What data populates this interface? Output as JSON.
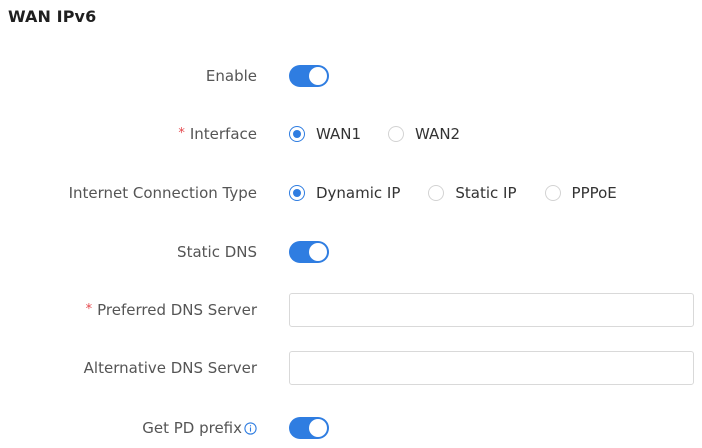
{
  "section": {
    "title": "WAN IPv6"
  },
  "form": {
    "enable": {
      "label": "Enable",
      "on": true
    },
    "interface": {
      "label": "Interface",
      "required_mark": "*",
      "options": [
        "WAN1",
        "WAN2"
      ],
      "selected": "WAN1"
    },
    "connection_type": {
      "label": "Internet Connection Type",
      "options": [
        "Dynamic IP",
        "Static IP",
        "PPPoE"
      ],
      "selected": "Dynamic IP"
    },
    "static_dns": {
      "label": "Static DNS",
      "on": true
    },
    "preferred_dns": {
      "label": "Preferred DNS Server",
      "required_mark": "*",
      "value": ""
    },
    "alternative_dns": {
      "label": "Alternative DNS Server",
      "value": ""
    },
    "pd_prefix": {
      "label": "Get PD prefix",
      "on": true,
      "icon": "info-icon"
    }
  },
  "colors": {
    "accent": "#2f7de1",
    "required": "#e5484d",
    "label": "#555555"
  }
}
